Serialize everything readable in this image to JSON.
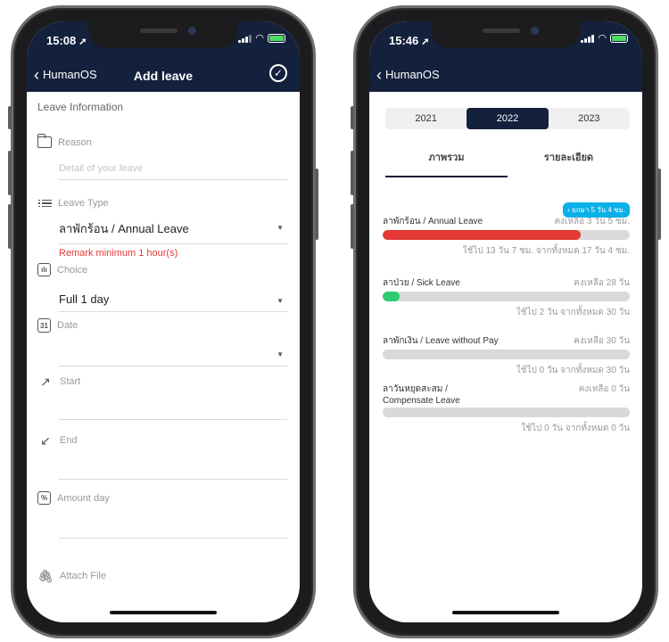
{
  "left_phone": {
    "status": {
      "time": "15:08"
    },
    "nav": {
      "back_label": "HumanOS",
      "title": "Add leave"
    },
    "form": {
      "section_title": "Leave Information",
      "reason": {
        "label": "Reason",
        "placeholder": "Detail of your leave"
      },
      "leave_type": {
        "label": "Leave Type",
        "value": "ลาพักร้อน / Annual Leave",
        "remark": "Remark minimum 1 hour(s)"
      },
      "choice": {
        "label": "Choice",
        "value": "Full 1 day"
      },
      "date": {
        "label": "Date",
        "value": ""
      },
      "start": {
        "label": "Start",
        "value": ""
      },
      "end": {
        "label": "End",
        "value": ""
      },
      "amount": {
        "label": "Amount day",
        "value": ""
      },
      "attach": {
        "label": "Attach File"
      }
    }
  },
  "right_phone": {
    "status": {
      "time": "15:46"
    },
    "nav": {
      "back_label": "HumanOS"
    },
    "years": [
      {
        "label": "2021",
        "active": false
      },
      {
        "label": "2022",
        "active": true
      },
      {
        "label": "2023",
        "active": false
      }
    ],
    "tabs": [
      {
        "label": "ภาพรวม",
        "active": true
      },
      {
        "label": "รายละเอียด",
        "active": false
      }
    ],
    "badge": "‹ ยกมา 5 วัน 4 ชม.",
    "leaves": [
      {
        "name": "ลาพักร้อน / Annual Leave",
        "remaining": "คงเหลือ 3 วัน 5 ชม.",
        "used": "ใช้ไป 13 วัน 7 ชม. จากทั้งหมด 17 วัน 4 ชม.",
        "fraction": 0.8,
        "color": "#e53935"
      },
      {
        "name": "ลาป่วย / Sick Leave",
        "remaining": "คงเหลือ 28 วัน",
        "used": "ใช้ไป 2 วัน จากทั้งหมด 30 วัน",
        "fraction": 0.067,
        "color": "#2ecc71"
      },
      {
        "name": "ลาพักเงิน / Leave without Pay",
        "remaining": "คงเหลือ 30 วัน",
        "used": "ใช้ไป 0 วัน จากทั้งหมด 30 วัน",
        "fraction": 0,
        "color": "#2ecc71"
      },
      {
        "name": "ลาวันหยุดสะสม / Compensate Leave",
        "remaining": "คงเหลือ 0 วัน",
        "used": "ใช้ไป 0 วัน จากทั้งหมด 0 วัน",
        "fraction": 0,
        "color": "#2ecc71"
      }
    ]
  }
}
